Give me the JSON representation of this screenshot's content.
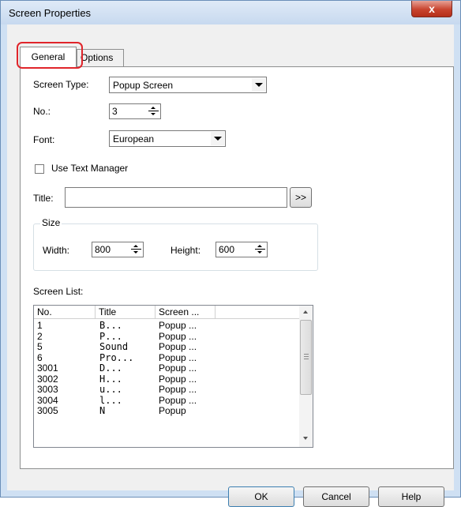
{
  "window": {
    "title": "Screen Properties",
    "close_glyph": "x"
  },
  "tabs": [
    {
      "label": "General"
    },
    {
      "label": "Options"
    }
  ],
  "screen_type": {
    "label": "Screen Type:",
    "value": "Popup Screen"
  },
  "no": {
    "label": "No.:",
    "value": "3"
  },
  "font": {
    "label": "Font:",
    "value": "European"
  },
  "use_text_manager": {
    "label": "Use Text Manager",
    "checked": false
  },
  "title_field": {
    "label": "Title:",
    "value": "",
    "browse_label": ">>"
  },
  "size": {
    "legend": "Size",
    "width_label": "Width:",
    "width_value": "800",
    "height_label": "Height:",
    "height_value": "600"
  },
  "screen_list": {
    "label": "Screen List:",
    "columns": [
      "No.",
      "Title",
      "Screen ..."
    ],
    "rows": [
      {
        "no": "1",
        "title": "B...",
        "screen": "Popup ..."
      },
      {
        "no": "2",
        "title": "P...",
        "screen": "Popup ..."
      },
      {
        "no": "5",
        "title": "Sound",
        "screen": "Popup ..."
      },
      {
        "no": "6",
        "title": "Pro...",
        "screen": "Popup ..."
      },
      {
        "no": "3001",
        "title": "D...",
        "screen": "Popup ..."
      },
      {
        "no": "3002",
        "title": "H...",
        "screen": "Popup ..."
      },
      {
        "no": "3003",
        "title": "u...",
        "screen": "Popup ..."
      },
      {
        "no": "3004",
        "title": "l...",
        "screen": "Popup ..."
      },
      {
        "no": "3005",
        "title": "N",
        "screen": "Popup"
      }
    ]
  },
  "buttons": {
    "ok": "OK",
    "cancel": "Cancel",
    "help": "Help"
  },
  "colors": {
    "highlight_ring": "#e0252b",
    "close_button": "#c8442f"
  }
}
